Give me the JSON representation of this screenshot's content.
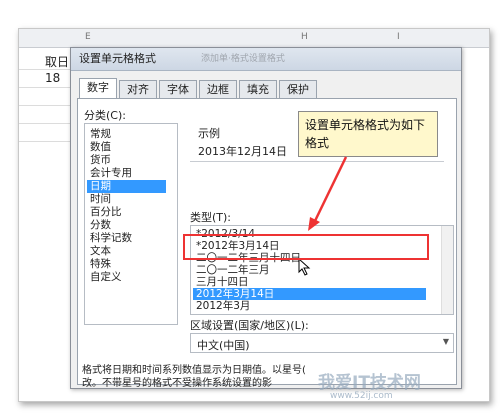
{
  "sheet": {
    "col_e": "E",
    "col_h": "H",
    "col_i": "I",
    "cell_top": "取日",
    "cell_value": "18"
  },
  "dialog": {
    "title": "设置单元格格式",
    "title_ghost": "添加单·格式设置格式",
    "tabs": [
      "数字",
      "对齐",
      "字体",
      "边框",
      "填充",
      "保护"
    ],
    "category_label": "分类(C):",
    "categories": [
      "常规",
      "数值",
      "货币",
      "会计专用",
      "日期",
      "时间",
      "百分比",
      "分数",
      "科学记数",
      "文本",
      "特殊",
      "自定义"
    ],
    "selected_category": "日期",
    "sample_label": "示例",
    "sample_value": "2013年12月14日",
    "type_label": "类型(T):",
    "types": [
      "*2012/3/14",
      "*2012年3月14日",
      "二〇一二年三月十四日",
      "二〇一二年三月",
      "三月十四日",
      "2012年3月14日",
      "2012年3月"
    ],
    "selected_type": "2012年3月14日",
    "locale_label": "区域设置(国家/地区)(L):",
    "locale_value": "中文(中国)",
    "footer_line1": "格式将日期和时间系列数值显示为日期值。以星号(",
    "footer_line2": "改。不带星号的格式不受操作系统设置的影"
  },
  "callout": {
    "text": "设置单元格格式为如下格式"
  },
  "watermark": {
    "site_name": "我爱IT技术网",
    "site_url": "www.52ij.com"
  },
  "colors": {
    "selection": "#3399ff",
    "highlight_border": "#e33333",
    "arrow": "#e33333",
    "callout_bg": "#fff8cc"
  }
}
